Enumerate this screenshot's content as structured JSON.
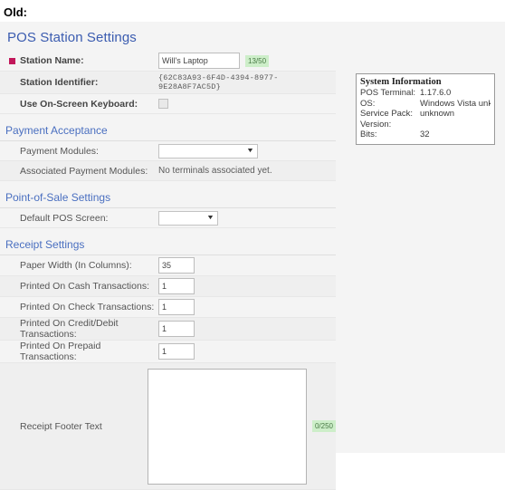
{
  "screenshot_caption": "Old:",
  "page": {
    "title": "POS Station Settings"
  },
  "station_fields": {
    "station_name": {
      "label": "Station Name:",
      "value": "Will's Laptop",
      "counter": "13/50",
      "required": true
    },
    "station_identifier": {
      "label": "Station Identifier:",
      "value": "{62C83A93-6F4D-4394-8977-9E28A8F7AC5D}"
    },
    "on_screen_keyboard": {
      "label": "Use On-Screen Keyboard:",
      "checked": false
    }
  },
  "payment_acceptance": {
    "heading": "Payment Acceptance",
    "payment_modules": {
      "label": "Payment Modules:",
      "value": ""
    },
    "associated_payment_modules": {
      "label": "Associated Payment Modules:",
      "value": "No terminals associated yet."
    }
  },
  "pos_settings": {
    "heading": "Point-of-Sale Settings",
    "default_pos_screen": {
      "label": "Default POS Screen:",
      "value": ""
    }
  },
  "receipt_settings": {
    "heading": "Receipt Settings",
    "paper_width": {
      "label": "Paper Width (In Columns):",
      "value": "35"
    },
    "cash": {
      "label": "Printed On Cash Transactions:",
      "value": "1"
    },
    "check": {
      "label": "Printed On Check Transactions:",
      "value": "1"
    },
    "credit_debit": {
      "label": "Printed On Credit/Debit Transactions:",
      "value": "1"
    },
    "prepaid": {
      "label": "Printed On Prepaid Transactions:",
      "value": "1"
    },
    "footer_text": {
      "label": "Receipt Footer Text",
      "value": "",
      "counter": "0/250"
    }
  },
  "system_information": {
    "title": "System Information",
    "rows": [
      {
        "key": "POS Terminal:",
        "value": "1.17.6.0"
      },
      {
        "key": "OS:",
        "value": "Windows Vista unknown"
      },
      {
        "key": "Service Pack:",
        "value": "unknown"
      },
      {
        "key": "Version:",
        "value": ""
      },
      {
        "key": "Bits:",
        "value": "32"
      }
    ]
  },
  "colors": {
    "heading_blue": "#4a6fc0",
    "title_blue": "#3b5cb0",
    "required_marker": "#c2185b",
    "counter_badge_bg": "#cdeec9",
    "page_bg": "#f4f4f4"
  }
}
